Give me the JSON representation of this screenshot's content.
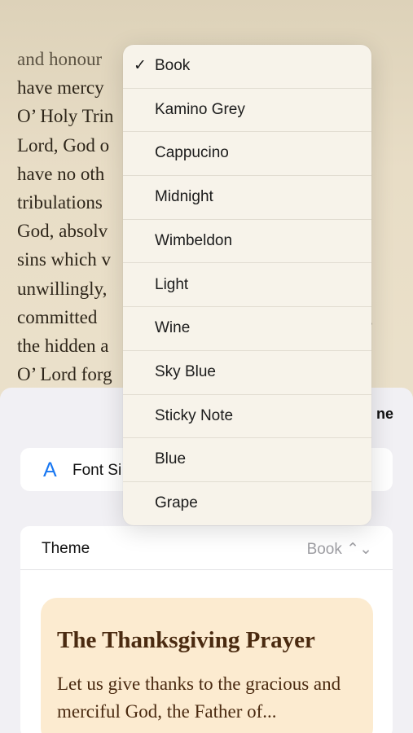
{
  "book": {
    "lines": [
      "and honour",
      "have mercy",
      "O’ Holy Trin",
      "Lord, God o",
      "have no oth",
      "tribulations",
      "God, absolv",
      "sins which v",
      "unwillingly,",
      "committed",
      "the hidden a",
      "O’ Lord forg"
    ],
    "fragment": ","
  },
  "menu": {
    "items": [
      {
        "label": "Book",
        "checked": true
      },
      {
        "label": "Kamino Grey",
        "checked": false
      },
      {
        "label": "Cappucino",
        "checked": false
      },
      {
        "label": "Midnight",
        "checked": false
      },
      {
        "label": "Wimbeldon",
        "checked": false
      },
      {
        "label": "Light",
        "checked": false
      },
      {
        "label": "Wine",
        "checked": false
      },
      {
        "label": "Sky Blue",
        "checked": false
      },
      {
        "label": "Sticky Note",
        "checked": false
      },
      {
        "label": "Blue",
        "checked": false
      },
      {
        "label": "Grape",
        "checked": false
      }
    ],
    "check_glyph": "✓"
  },
  "sheet": {
    "done_label": "ne",
    "font_size_icon": "A",
    "font_size_label": "Font Si",
    "theme_label": "Theme",
    "theme_value": "Book ⌃⌄",
    "preview_title": "The Thanksgiving Prayer",
    "preview_body": "Let us give thanks to the gracious and merciful God, the Father of..."
  },
  "colors": {
    "accent": "#1877f2",
    "preview_bg": "#fcebd0",
    "preview_text": "#4a2a10"
  }
}
